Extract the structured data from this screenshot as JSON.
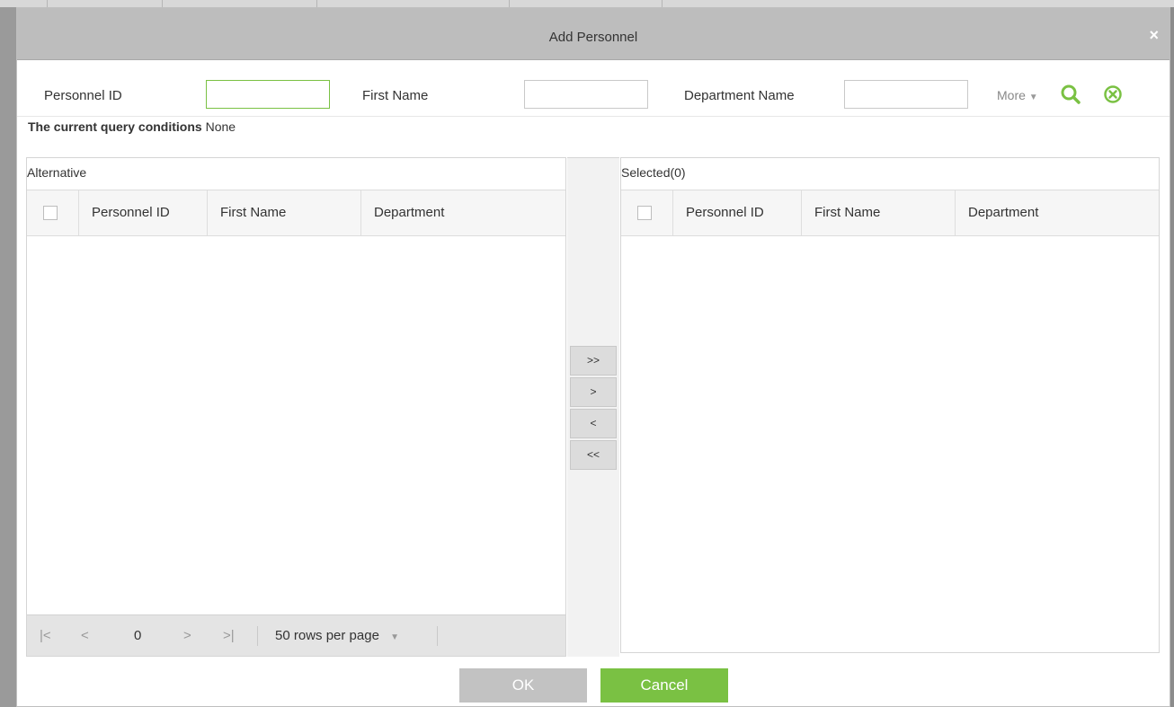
{
  "dialog": {
    "title": "Add Personnel",
    "close_label": "×"
  },
  "search": {
    "personnel_id_label": "Personnel ID",
    "personnel_id_value": "",
    "first_name_label": "First Name",
    "first_name_value": "",
    "department_name_label": "Department Name",
    "department_name_value": "",
    "more_label": "More",
    "conditions_label": "The current query conditions",
    "conditions_value": "None"
  },
  "alternative": {
    "title": "Alternative",
    "columns": [
      "Personnel ID",
      "First Name",
      "Department"
    ],
    "rows": []
  },
  "selected": {
    "title": "Selected(0)",
    "columns": [
      "Personnel ID",
      "First Name",
      "Department"
    ],
    "rows": []
  },
  "pager": {
    "first": "|<",
    "prev": "<",
    "page": "0",
    "next": ">",
    "last": ">|",
    "rows_per_page": "50 rows per page"
  },
  "transfer": {
    "add_all": ">>",
    "add_one": ">",
    "remove_one": "<",
    "remove_all": "<<"
  },
  "buttons": {
    "ok": "OK",
    "cancel": "Cancel"
  },
  "colors": {
    "accent": "#7ac143",
    "disabled": "#c2c2c2",
    "titlebar": "#bdbdbd"
  },
  "icons": {
    "search": "search-icon",
    "clear": "clear-circle-icon",
    "close": "close-icon"
  }
}
